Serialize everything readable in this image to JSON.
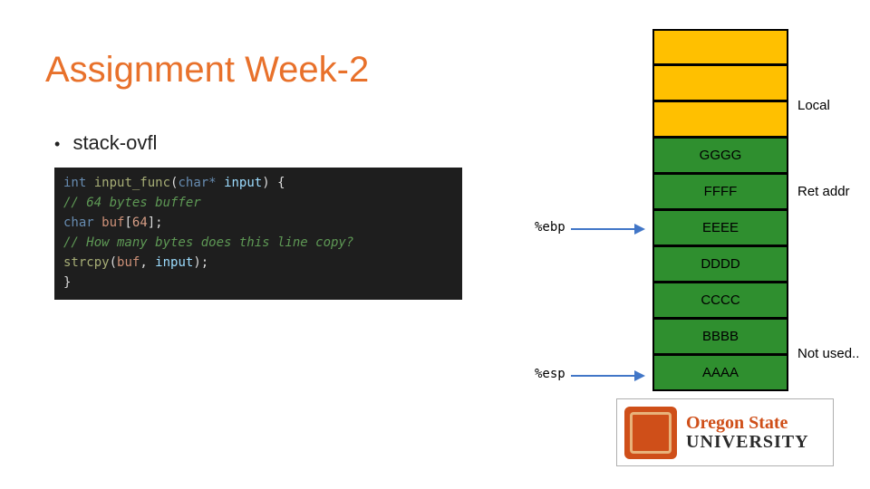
{
  "title": "Assignment Week-2",
  "bullet": "stack-ovfl",
  "code": {
    "sig_type": "int",
    "sig_name": "input_func",
    "sig_paramtype": "char*",
    "sig_paramname": "input",
    "c1": "// 64 bytes buffer",
    "decl_type": "char",
    "decl_name": "buf",
    "decl_size": "64",
    "c2": "// How many bytes does this line copy?",
    "call": "strcpy",
    "arg1": "buf",
    "arg2": "input"
  },
  "stack": {
    "g": "GGGG",
    "f": "FFFF",
    "e": "EEEE",
    "d": "DDDD",
    "c": "CCCC",
    "b": "BBBB",
    "a": "AAAA"
  },
  "labels": {
    "local": "Local",
    "retaddr": "Ret addr",
    "notused": "Not used..",
    "ebp": "%ebp",
    "esp": "%esp"
  },
  "logo": {
    "line1a": "Oregon",
    "line1b": "State",
    "line2": "UNIVERSITY"
  }
}
